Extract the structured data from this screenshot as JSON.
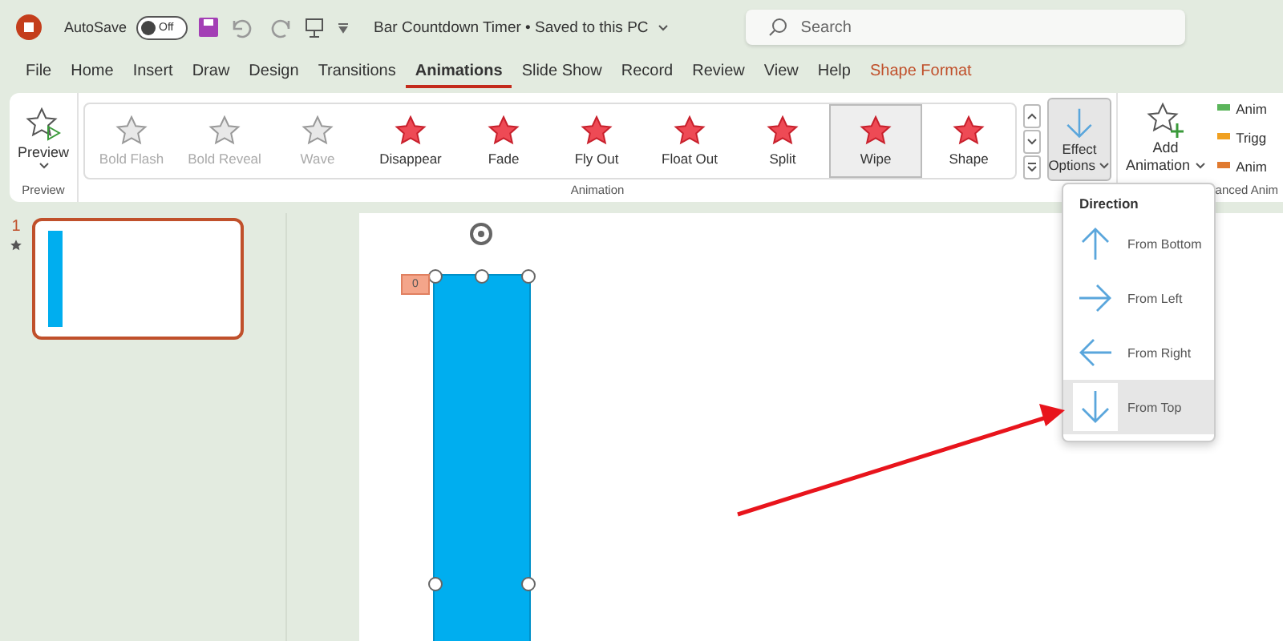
{
  "title_bar": {
    "autosave_label": "AutoSave",
    "autosave_toggle": {
      "label": "Off",
      "on": false
    },
    "document_title": "Bar Countdown Timer • Saved to this PC",
    "search": {
      "placeholder": "Search"
    }
  },
  "ribbon_tabs": [
    {
      "label": "File",
      "selected": false,
      "kind": "plain"
    },
    {
      "label": "Home",
      "selected": false,
      "kind": "plain"
    },
    {
      "label": "Insert",
      "selected": false,
      "kind": "plain"
    },
    {
      "label": "Draw",
      "selected": false,
      "kind": "plain"
    },
    {
      "label": "Design",
      "selected": false,
      "kind": "plain"
    },
    {
      "label": "Transitions",
      "selected": false,
      "kind": "plain"
    },
    {
      "label": "Animations",
      "selected": true,
      "kind": "plain"
    },
    {
      "label": "Slide Show",
      "selected": false,
      "kind": "plain"
    },
    {
      "label": "Record",
      "selected": false,
      "kind": "plain"
    },
    {
      "label": "Review",
      "selected": false,
      "kind": "plain"
    },
    {
      "label": "View",
      "selected": false,
      "kind": "plain"
    },
    {
      "label": "Help",
      "selected": false,
      "kind": "plain"
    },
    {
      "label": "Shape Format",
      "selected": false,
      "kind": "contextual"
    }
  ],
  "ribbon": {
    "preview_button": "Preview",
    "preview_group": "Preview",
    "animations": [
      {
        "label": "Bold Flash",
        "disabled": true,
        "selected": false
      },
      {
        "label": "Bold Reveal",
        "disabled": true,
        "selected": false
      },
      {
        "label": "Wave",
        "disabled": true,
        "selected": false
      },
      {
        "label": "Disappear",
        "disabled": false,
        "selected": false
      },
      {
        "label": "Fade",
        "disabled": false,
        "selected": false
      },
      {
        "label": "Fly Out",
        "disabled": false,
        "selected": false
      },
      {
        "label": "Float Out",
        "disabled": false,
        "selected": false
      },
      {
        "label": "Split",
        "disabled": false,
        "selected": false
      },
      {
        "label": "Wipe",
        "disabled": false,
        "selected": true
      },
      {
        "label": "Shape",
        "disabled": false,
        "selected": false
      }
    ],
    "animation_group": "Animation",
    "effect_options": {
      "line1": "Effect",
      "line2": "Options"
    },
    "add_animation": {
      "line1": "Add",
      "line2": "Animation"
    },
    "advanced_items": [
      "Anim",
      "Trigg",
      "Anim"
    ],
    "advanced_group": "anced Anim"
  },
  "slides_pane": {
    "slides": [
      {
        "number": "1",
        "selected": true
      }
    ]
  },
  "slide": {
    "animation_tag": "0"
  },
  "direction_menu": {
    "title": "Direction",
    "items": [
      {
        "label": "From Bottom",
        "kind": "up",
        "selected": false
      },
      {
        "label": "From Left",
        "kind": "right",
        "selected": false
      },
      {
        "label": "From Right",
        "kind": "left",
        "selected": false
      },
      {
        "label": "From Top",
        "kind": "down",
        "selected": true
      }
    ]
  }
}
